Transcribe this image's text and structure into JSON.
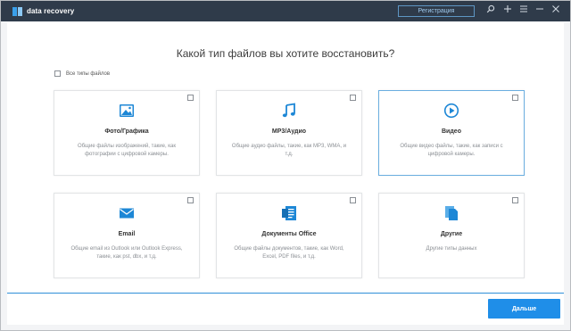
{
  "app": {
    "name": "data recovery",
    "register_label": "Регистрация"
  },
  "titlebar_icons": [
    "search-icon",
    "plus-icon",
    "menu-icon",
    "minimize-icon",
    "close-icon"
  ],
  "main": {
    "question": "Какой тип файлов вы хотите восстановить?",
    "all_types_label": "Все типы файлов",
    "cards": [
      {
        "icon": "photo-icon",
        "title": "Фото/Графика",
        "desc": "Общие файлы изображений, такие, как фотографии с цифровой камеры.",
        "selected": false
      },
      {
        "icon": "music-icon",
        "title": "MP3/Аудио",
        "desc": "Общие аудио файлы, такие, как MP3, WMA, и т.д.",
        "selected": false
      },
      {
        "icon": "video-icon",
        "title": "Видео",
        "desc": "Общие видео файлы, такие, как записи с цифровой камеры.",
        "selected": true
      },
      {
        "icon": "email-icon",
        "title": "Email",
        "desc": "Общие email из Outlook или Outlook Express, такие, как pst, dbx, и т.д.",
        "selected": false
      },
      {
        "icon": "document-icon",
        "title": "Документы Office",
        "desc": "Общие файлы документов, такие, как Word, Excel, PDF files, и т.д.",
        "selected": false
      },
      {
        "icon": "files-icon",
        "title": "Другие",
        "desc": "Другие типы данных",
        "selected": false
      }
    ]
  },
  "footer": {
    "next_label": "Дальше"
  },
  "colors": {
    "titlebar": "#2f3b4a",
    "accent": "#1f8ee8",
    "icon": "#1d87d6"
  }
}
